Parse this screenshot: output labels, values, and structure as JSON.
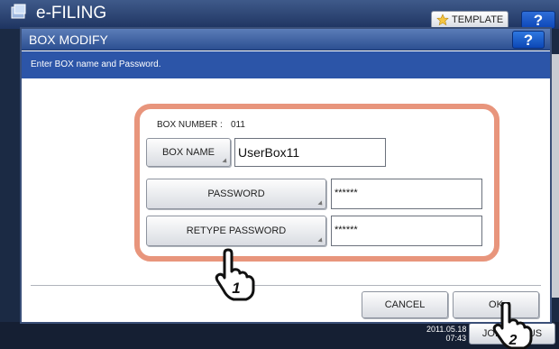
{
  "background": {
    "app_title": "e-FILING",
    "template_button": "TEMPLATE",
    "help_label": "?",
    "clock_date": "2011.05.18",
    "clock_time": "07:43",
    "job_status_button": "JOB STATUS"
  },
  "dialog": {
    "title": "BOX MODIFY",
    "help_label": "?",
    "message": "Enter BOX name and Password.",
    "box_number_label": "BOX NUMBER",
    "box_number_separator": ":",
    "box_number_value": "011",
    "box_name_button": "BOX NAME",
    "box_name_value": "UserBox11",
    "password_button": "PASSWORD",
    "password_value": "******",
    "retype_password_button": "RETYPE PASSWORD",
    "retype_password_value": "******",
    "cancel_button": "CANCEL",
    "ok_button": "OK"
  },
  "callouts": {
    "step1": "1",
    "step2": "2"
  },
  "colors": {
    "callout_frame": "#e8957c",
    "title_bar": "#2c4f91",
    "message_bar": "#2c55a8"
  }
}
